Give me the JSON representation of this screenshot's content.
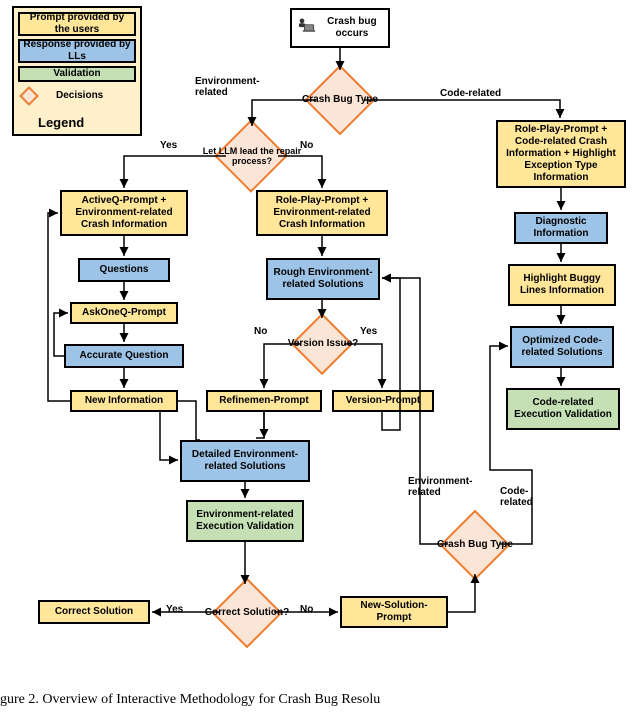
{
  "legend": {
    "title": "Legend",
    "items": {
      "prompt": "Prompt provided by the users",
      "response": "Response provided by LLs",
      "validation": "Validation",
      "decisions": "Decisions"
    }
  },
  "start": {
    "label": "Crash bug occurs"
  },
  "decisions": {
    "crash_type_top": "Crash Bug Type",
    "llm_lead": "Let LLM lead the repair process?",
    "version_issue": "Version Issue?",
    "correct_solution": "Correct Solution?",
    "crash_type_bottom": "Crash Bug Type"
  },
  "edges": {
    "env_related_top": "Environment-related",
    "code_related_top": "Code-related",
    "yes1": "Yes",
    "no1": "No",
    "yes2": "Yes",
    "no2": "No",
    "yes3": "Yes",
    "no3": "No",
    "env_related_side": "Environment-related",
    "code_related_side": "Code-related"
  },
  "prompts": {
    "activeq": "ActiveQ-Prompt + Environment-related Crash Information",
    "askoneq": "AskOneQ-Prompt",
    "new_info": "New Information",
    "refinement": "Refinemen-Prompt",
    "version": "Version-Prompt",
    "roleplay_env": "Role-Play-Prompt + Environment-related Crash Information",
    "roleplay_code": "Role-Play-Prompt + Code-related Crash Information + Highlight Exception Type Information",
    "highlight_buggy": "Highlight Buggy Lines Information",
    "new_solution": "New-Solution-Prompt",
    "correct_solution": "Correct Solution"
  },
  "responses": {
    "questions": "Questions",
    "accurate_q": "Accurate Question",
    "rough_env": "Rough Environment-related Solutions",
    "detailed_env": "Detailed Environment-related Solutions",
    "diagnostic": "Diagnostic Information",
    "optimized_code": "Optimized Code-related Solutions"
  },
  "validations": {
    "env_exec": "Environment-related Execution Validation",
    "code_exec": "Code-related Execution Validation"
  },
  "caption": "gure 2.  Overview of Interactive Methodology for Crash Bug Resolu"
}
